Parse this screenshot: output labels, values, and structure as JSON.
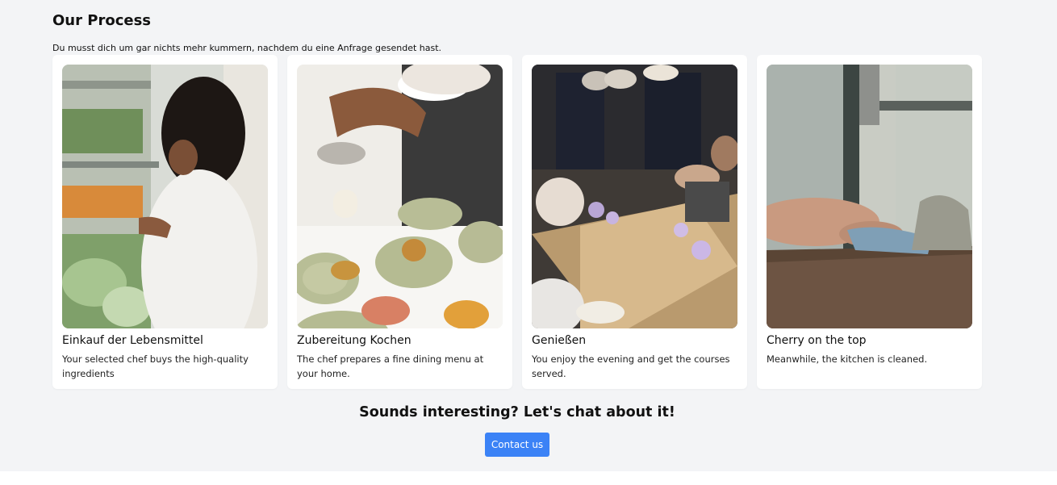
{
  "header": {
    "title": "Our Process",
    "subtitle": "Du musst dich um gar nichts mehr kummern, nachdem du eine Anfrage gesendet hast."
  },
  "steps": [
    {
      "title": "Einkauf der Lebensmittel",
      "text": "Your selected chef buys the high-quality ingredients",
      "image": "grocery-shopping-photo"
    },
    {
      "title": "Zubereitung Kochen",
      "text": "The chef prepares a fine dining menu at your home.",
      "image": "chef-plating-photo"
    },
    {
      "title": "Genießen",
      "text": "You enjoy the evening and get the courses served.",
      "image": "dinner-table-photo"
    },
    {
      "title": "Cherry on the top",
      "text": "Meanwhile, the kitchen is cleaned.",
      "image": "kitchen-cleaning-photo"
    }
  ],
  "cta": {
    "heading": "Sounds interesting? Let's chat about it!",
    "button_label": "Contact us",
    "button_color": "#3b82f6"
  }
}
